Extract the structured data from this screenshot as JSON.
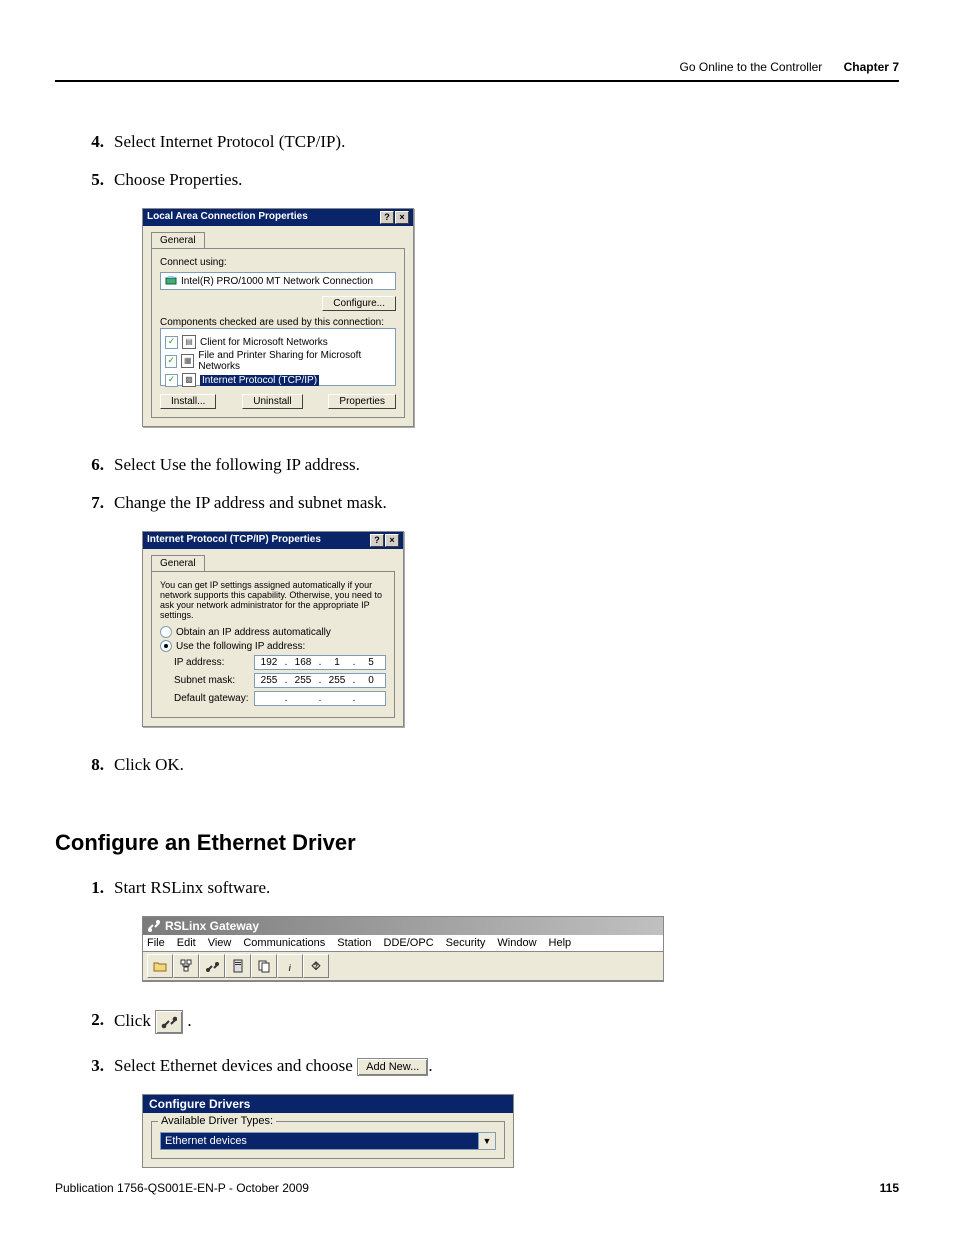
{
  "header": {
    "section_title": "Go Online to the Controller",
    "chapter_label": "Chapter 7"
  },
  "steps_a": [
    {
      "num": "4.",
      "text": "Select Internet Protocol (TCP/IP)."
    },
    {
      "num": "5.",
      "text": "Choose Properties."
    }
  ],
  "lac_dialog": {
    "title": "Local Area Connection Properties",
    "tab": "General",
    "connect_using_label": "Connect using:",
    "adapter": "Intel(R) PRO/1000 MT Network Connection",
    "configure_btn": "Configure...",
    "components_label": "Components checked are used by this connection:",
    "items": [
      "Client for Microsoft Networks",
      "File and Printer Sharing for Microsoft Networks",
      "Internet Protocol (TCP/IP)"
    ],
    "install_btn": "Install...",
    "uninstall_btn": "Uninstall",
    "properties_btn": "Properties"
  },
  "steps_b": [
    {
      "num": "6.",
      "text": "Select Use the following IP address."
    },
    {
      "num": "7.",
      "text": "Change the IP address and subnet mask."
    }
  ],
  "ip_dialog": {
    "title": "Internet Protocol (TCP/IP) Properties",
    "tab": "General",
    "desc": "You can get IP settings assigned automatically if your network supports this capability. Otherwise, you need to ask your network administrator for the appropriate IP settings.",
    "opt_auto": "Obtain an IP address automatically",
    "opt_manual": "Use the following IP address:",
    "ip_label": "IP address:",
    "ip": [
      "192",
      "168",
      "1",
      "5"
    ],
    "subnet_label": "Subnet mask:",
    "subnet": [
      "255",
      "255",
      "255",
      "0"
    ],
    "gateway_label": "Default gateway:"
  },
  "steps_c": [
    {
      "num": "8.",
      "text": "Click OK."
    }
  ],
  "section_heading": "Configure an Ethernet Driver",
  "steps_d": [
    {
      "num": "1.",
      "text": "Start RSLinx software."
    }
  ],
  "rslinx": {
    "title": "RSLinx Gateway",
    "menu": [
      "File",
      "Edit",
      "View",
      "Communications",
      "Station",
      "DDE/OPC",
      "Security",
      "Window",
      "Help"
    ]
  },
  "step2": {
    "num": "2.",
    "prefix": "Click ",
    "suffix": "."
  },
  "step3": {
    "num": "3.",
    "prefix": "Select Ethernet devices and choose ",
    "btn_label": "Add New...",
    "suffix": "."
  },
  "cfgdrv": {
    "title": "Configure Drivers",
    "group_label": "Available Driver Types:",
    "selected": "Ethernet devices"
  },
  "footer": {
    "pub": "Publication 1756-QS001E-EN-P - October 2009",
    "page": "115"
  }
}
